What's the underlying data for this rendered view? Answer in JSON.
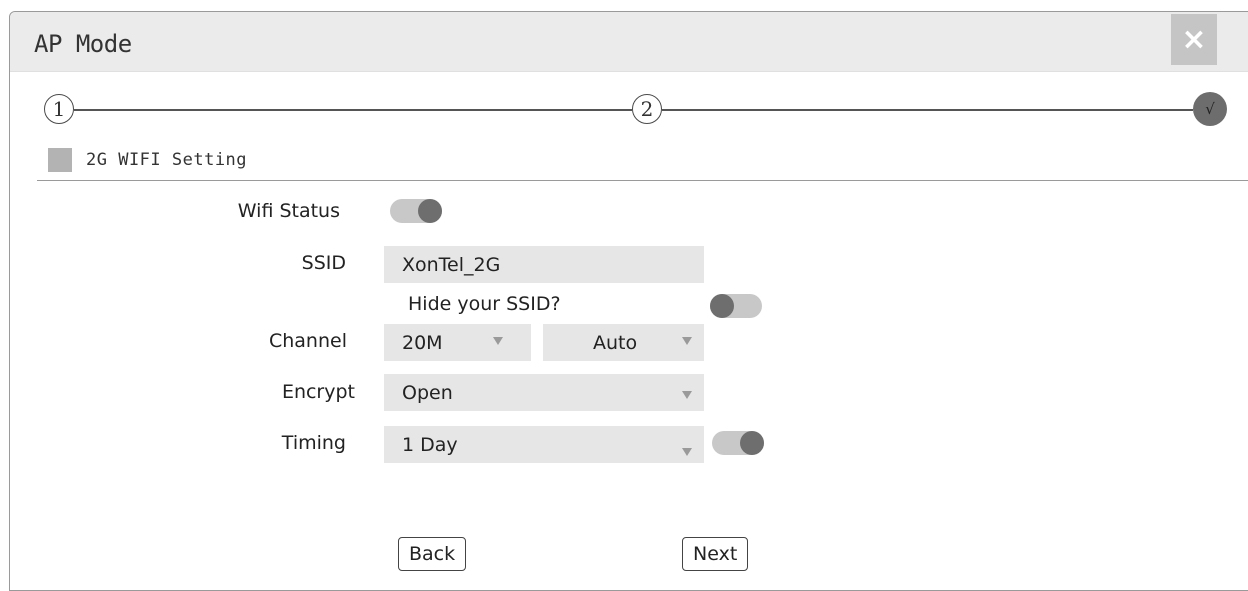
{
  "window": {
    "title": "AP Mode",
    "close_glyph": "×"
  },
  "stepper": {
    "steps": [
      "1",
      "2"
    ],
    "done_glyph": "√"
  },
  "section": {
    "title": "2G WIFI Setting"
  },
  "form": {
    "wifi_status": {
      "label": "Wifi Status",
      "state": "on"
    },
    "ssid": {
      "label": "SSID",
      "value": "XonTel_2G"
    },
    "hide_ssid": {
      "label": "Hide your SSID?",
      "state": "off"
    },
    "channel": {
      "label": "Channel",
      "bandwidth": "20M",
      "channel": "Auto"
    },
    "encrypt": {
      "label": "Encrypt",
      "value": "Open"
    },
    "timing": {
      "label": "Timing",
      "value": "1 Day",
      "state": "on"
    }
  },
  "buttons": {
    "back": "Back",
    "next": "Next"
  },
  "colors": {
    "titlebar": "#ebebeb",
    "field_bg": "#e6e6e6",
    "toggle_track": "#c8c8c8",
    "toggle_knob": "#6e6e6e",
    "close_bg": "#c5c5c5"
  }
}
